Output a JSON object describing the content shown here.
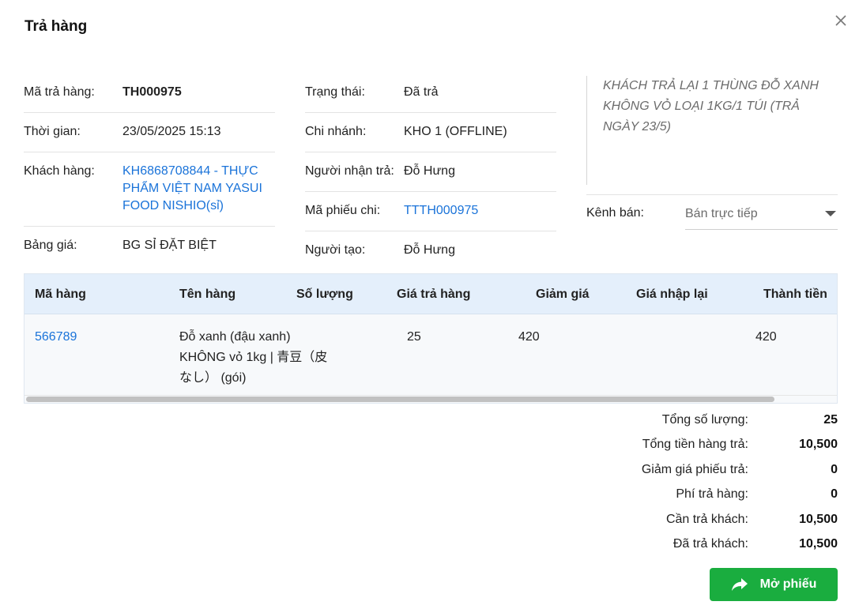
{
  "dialog": {
    "title": "Trả hàng"
  },
  "info": {
    "return_code_label": "Mã trả hàng:",
    "return_code": "TH000975",
    "time_label": "Thời gian:",
    "time": "23/05/2025 15:13",
    "customer_label": "Khách hàng:",
    "customer": "KH6868708844 - THỰC PHẨM VIỆT NAM YASUI FOOD NISHIO(sỉ)",
    "price_list_label": "Bảng giá:",
    "price_list": "BG SỈ ĐẶT BIỆT",
    "status_label": "Trạng thái:",
    "status": "Đã trả",
    "branch_label": "Chi nhánh:",
    "branch": "KHO 1 (OFFLINE)",
    "receiver_label": "Người nhận trả:",
    "receiver": "Đỗ Hưng",
    "payment_code_label": "Mã phiếu chi:",
    "payment_code": "TTTH000975",
    "creator_label": "Người tạo:",
    "creator": "Đỗ Hưng"
  },
  "note": "KHÁCH TRẢ LẠI 1 THÙNG ĐỖ XANH KHÔNG VỎ LOẠI 1KG/1 TÚI (TRẢ NGÀY 23/5)",
  "channel": {
    "label": "Kênh bán:",
    "selected": "Bán trực tiếp"
  },
  "table": {
    "headers": {
      "code": "Mã hàng",
      "name": "Tên hàng",
      "qty": "Số lượng",
      "return_price": "Giá trả hàng",
      "discount": "Giảm giá",
      "reimport_price": "Giá nhập lại",
      "total": "Thành tiền"
    },
    "rows": [
      {
        "code": "566789",
        "name_line1": "Đỗ xanh (đậu xanh)",
        "name_line2": "KHÔNG vỏ 1kg | 青豆（皮",
        "name_line3": "なし） (gói)",
        "qty": "25",
        "return_price": "420",
        "discount": "",
        "reimport_price": "",
        "total": "420"
      }
    ]
  },
  "totals": {
    "total_qty_label": "Tổng số lượng:",
    "total_qty": "25",
    "total_goods_label": "Tổng tiền hàng trả:",
    "total_goods": "10,500",
    "discount_label": "Giảm giá phiếu trả:",
    "discount": "0",
    "fee_label": "Phí trả hàng:",
    "fee": "0",
    "to_pay_label": "Cần trả khách:",
    "to_pay": "10,500",
    "paid_label": "Đã trả khách:",
    "paid": "10,500"
  },
  "actions": {
    "open_label": "Mở phiếu"
  },
  "colors": {
    "link": "#1a73d9",
    "primary_button": "#1aad3f",
    "table_header": "#e4effb"
  }
}
